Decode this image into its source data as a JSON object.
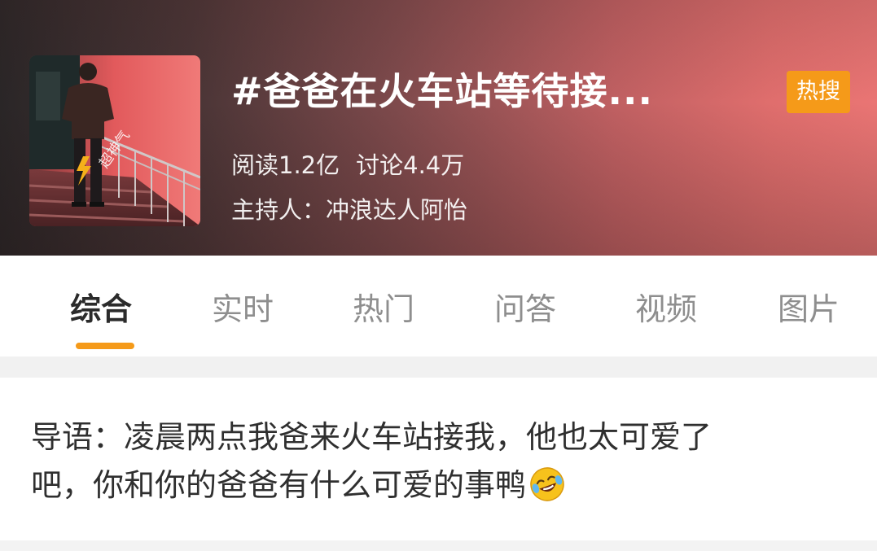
{
  "header": {
    "title": "#爸爸在火车站等待接...",
    "badge": "热搜",
    "reads": "阅读1.2亿",
    "discussions": "讨论4.4万",
    "host": "主持人：冲浪达人阿怡",
    "thumbnail_watermark": "超神气"
  },
  "tabs": [
    {
      "label": "综合",
      "active": true
    },
    {
      "label": "实时"
    },
    {
      "label": "热门"
    },
    {
      "label": "问答"
    },
    {
      "label": "视频"
    },
    {
      "label": "图片"
    }
  ],
  "intro": {
    "line1": "导语：凌晨两点我爸来火车站接我，他也太可爱了",
    "line2": "吧，你和你的爸爸有什么可爱的事鸭",
    "emoji": "laughing-crying-emoji"
  },
  "colors": {
    "accent": "#f59a19",
    "active_tab": "#2b2b2b",
    "inactive_tab": "#8e8e8e"
  }
}
